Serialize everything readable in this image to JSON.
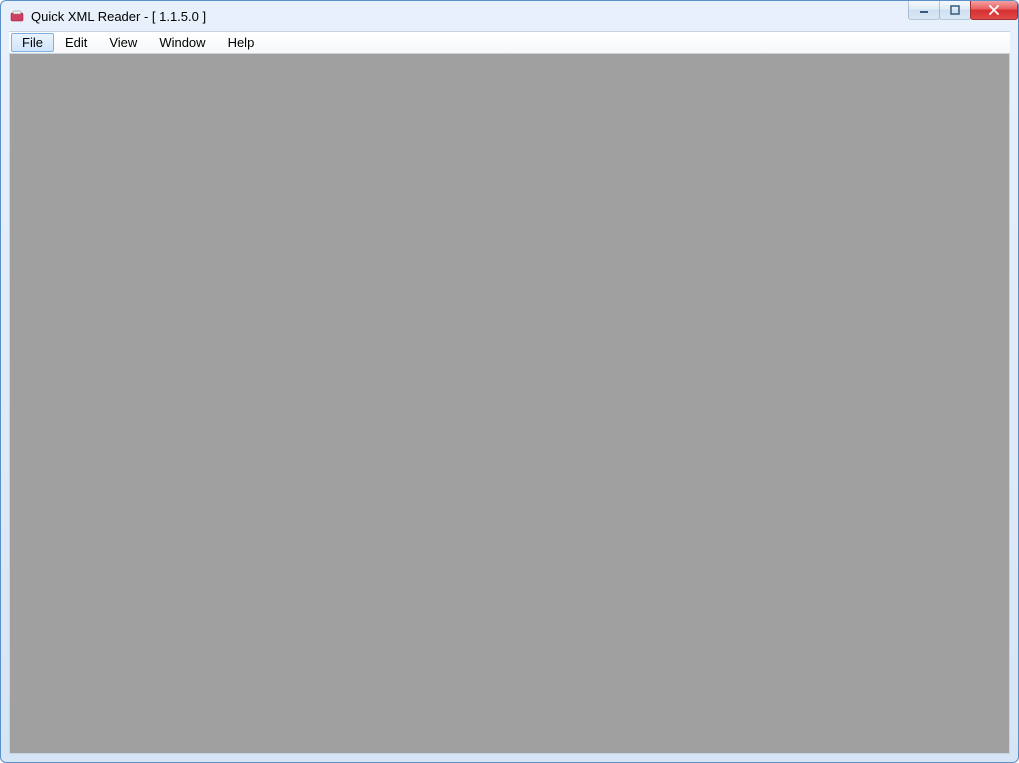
{
  "window": {
    "title": "Quick XML Reader - [ 1.1.5.0 ]"
  },
  "menubar": {
    "items": [
      {
        "label": "File",
        "selected": true
      },
      {
        "label": "Edit",
        "selected": false
      },
      {
        "label": "View",
        "selected": false
      },
      {
        "label": "Window",
        "selected": false
      },
      {
        "label": "Help",
        "selected": false
      }
    ]
  }
}
